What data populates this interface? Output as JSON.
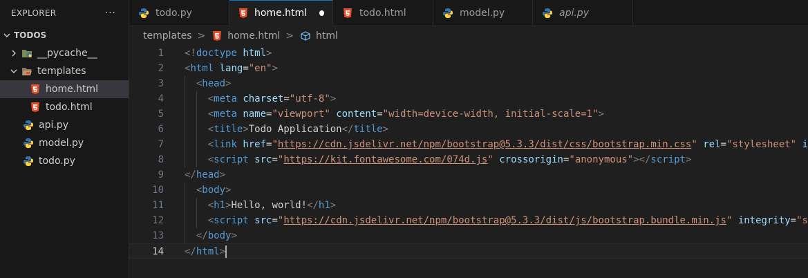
{
  "explorer": {
    "title": "EXPLORER",
    "more_label": "···",
    "root_label": "TODOS",
    "items": [
      {
        "label": "__pycache__",
        "icon": "python-folder-icon"
      },
      {
        "label": "templates",
        "icon": "folder-open-icon"
      },
      {
        "label": "home.html",
        "icon": "html5-icon"
      },
      {
        "label": "todo.html",
        "icon": "html5-icon"
      },
      {
        "label": "api.py",
        "icon": "python-icon"
      },
      {
        "label": "model.py",
        "icon": "python-icon"
      },
      {
        "label": "todo.py",
        "icon": "python-icon"
      }
    ]
  },
  "tabs": [
    {
      "label": "todo.py",
      "icon": "python-icon"
    },
    {
      "label": "home.html",
      "icon": "html5-icon",
      "active": true,
      "modified": true
    },
    {
      "label": "todo.html",
      "icon": "html5-icon"
    },
    {
      "label": "model.py",
      "icon": "python-icon"
    },
    {
      "label": "api.py",
      "icon": "python-icon",
      "italic": true
    }
  ],
  "breadcrumb": {
    "folder": "templates",
    "file": "home.html",
    "symbol": "html",
    "separator": ">"
  },
  "editor": {
    "current_line": 14,
    "lines": [
      {
        "num": "1",
        "tokens": [
          [
            "br",
            "<!"
          ],
          [
            "tag",
            "doctype"
          ],
          [
            "text",
            " "
          ],
          [
            "attr",
            "html"
          ],
          [
            "br",
            ">"
          ]
        ]
      },
      {
        "num": "2",
        "tokens": [
          [
            "br",
            "<"
          ],
          [
            "tag",
            "html"
          ],
          [
            "text",
            " "
          ],
          [
            "attr",
            "lang"
          ],
          [
            "text",
            "="
          ],
          [
            "str",
            "\"en\""
          ],
          [
            "br",
            ">"
          ]
        ]
      },
      {
        "num": "3",
        "indent": 1,
        "tokens": [
          [
            "br",
            "<"
          ],
          [
            "tag",
            "head"
          ],
          [
            "br",
            ">"
          ]
        ]
      },
      {
        "num": "4",
        "indent": 2,
        "tokens": [
          [
            "br",
            "<"
          ],
          [
            "tag",
            "meta"
          ],
          [
            "text",
            " "
          ],
          [
            "attr",
            "charset"
          ],
          [
            "text",
            "="
          ],
          [
            "str",
            "\"utf-8\""
          ],
          [
            "br",
            ">"
          ]
        ]
      },
      {
        "num": "5",
        "indent": 2,
        "tokens": [
          [
            "br",
            "<"
          ],
          [
            "tag",
            "meta"
          ],
          [
            "text",
            " "
          ],
          [
            "attr",
            "name"
          ],
          [
            "text",
            "="
          ],
          [
            "str",
            "\"viewport\""
          ],
          [
            "text",
            " "
          ],
          [
            "attr",
            "content"
          ],
          [
            "text",
            "="
          ],
          [
            "str",
            "\"width=device-width, initial-scale=1\""
          ],
          [
            "br",
            ">"
          ]
        ]
      },
      {
        "num": "6",
        "indent": 2,
        "tokens": [
          [
            "br",
            "<"
          ],
          [
            "tag",
            "title"
          ],
          [
            "br",
            ">"
          ],
          [
            "text",
            "Todo Application"
          ],
          [
            "br",
            "</"
          ],
          [
            "tag",
            "title"
          ],
          [
            "br",
            ">"
          ]
        ]
      },
      {
        "num": "7",
        "indent": 2,
        "tokens": [
          [
            "br",
            "<"
          ],
          [
            "tag",
            "link"
          ],
          [
            "text",
            " "
          ],
          [
            "attr",
            "href"
          ],
          [
            "text",
            "="
          ],
          [
            "str",
            "\""
          ],
          [
            "url",
            "https://cdn.jsdelivr.net/npm/bootstrap@5.3.3/dist/css/bootstrap.min.css"
          ],
          [
            "str",
            "\""
          ],
          [
            "text",
            " "
          ],
          [
            "attr",
            "rel"
          ],
          [
            "text",
            "="
          ],
          [
            "str",
            "\"stylesheet\""
          ],
          [
            "text",
            " "
          ],
          [
            "attr",
            "i"
          ]
        ]
      },
      {
        "num": "8",
        "indent": 2,
        "tokens": [
          [
            "br",
            "<"
          ],
          [
            "tag",
            "script"
          ],
          [
            "text",
            " "
          ],
          [
            "attr",
            "src"
          ],
          [
            "text",
            "="
          ],
          [
            "str",
            "\""
          ],
          [
            "url",
            "https://kit.fontawesome.com/074d.js"
          ],
          [
            "str",
            "\""
          ],
          [
            "text",
            " "
          ],
          [
            "attr",
            "crossorigin"
          ],
          [
            "text",
            "="
          ],
          [
            "str",
            "\"anonymous\""
          ],
          [
            "br",
            "></"
          ],
          [
            "tag",
            "script"
          ],
          [
            "br",
            ">"
          ]
        ]
      },
      {
        "num": "9",
        "indent": 0,
        "tokens": [
          [
            "br",
            "</"
          ],
          [
            "tag",
            "head"
          ],
          [
            "br",
            ">"
          ]
        ]
      },
      {
        "num": "10",
        "indent": 1,
        "tokens": [
          [
            "br",
            "<"
          ],
          [
            "tag",
            "body"
          ],
          [
            "br",
            ">"
          ]
        ]
      },
      {
        "num": "11",
        "indent": 2,
        "tokens": [
          [
            "br",
            "<"
          ],
          [
            "tag",
            "h1"
          ],
          [
            "br",
            ">"
          ],
          [
            "text",
            "Hello, world!"
          ],
          [
            "br",
            "</"
          ],
          [
            "tag",
            "h1"
          ],
          [
            "br",
            ">"
          ]
        ]
      },
      {
        "num": "12",
        "indent": 2,
        "tokens": [
          [
            "br",
            "<"
          ],
          [
            "tag",
            "script"
          ],
          [
            "text",
            " "
          ],
          [
            "attr",
            "src"
          ],
          [
            "text",
            "="
          ],
          [
            "str",
            "\""
          ],
          [
            "url",
            "https://cdn.jsdelivr.net/npm/bootstrap@5.3.3/dist/js/bootstrap.bundle.min.js"
          ],
          [
            "str",
            "\""
          ],
          [
            "text",
            " "
          ],
          [
            "attr",
            "integrity"
          ],
          [
            "text",
            "="
          ],
          [
            "str",
            "\"s"
          ]
        ]
      },
      {
        "num": "13",
        "indent": 1,
        "tokens": [
          [
            "br",
            "</"
          ],
          [
            "tag",
            "body"
          ],
          [
            "br",
            ">"
          ]
        ]
      },
      {
        "num": "14",
        "indent": 0,
        "tokens": [
          [
            "br",
            "</"
          ],
          [
            "tag",
            "html"
          ],
          [
            "br",
            ">"
          ]
        ]
      }
    ]
  },
  "colors": {
    "accent": "#0078d4",
    "html_icon": "#e44d26",
    "python_blue": "#3572a5",
    "python_yellow": "#ffd43b"
  }
}
